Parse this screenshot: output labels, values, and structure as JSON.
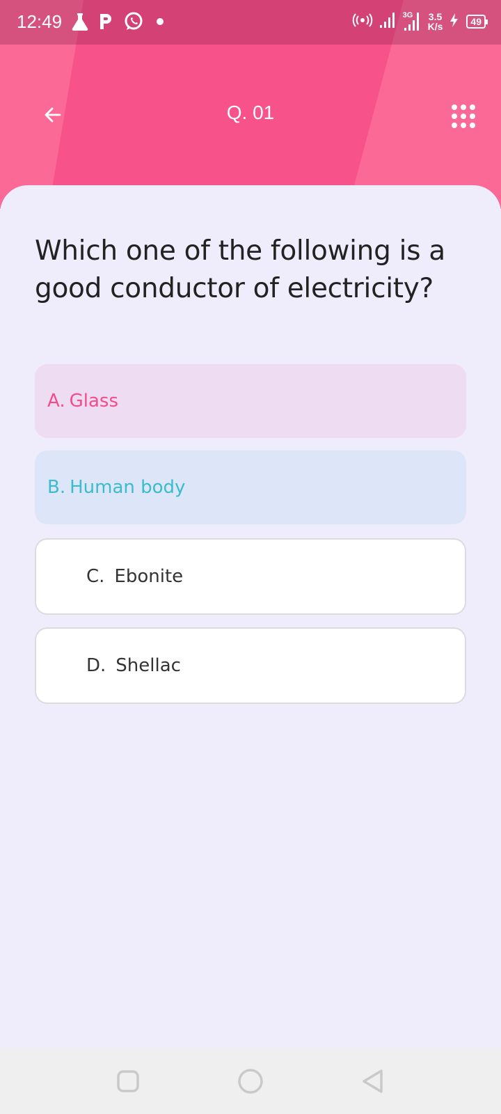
{
  "status_bar": {
    "time": "12:49",
    "network_speed_value": "3.5",
    "network_speed_unit": "K/s",
    "network_type": "3G",
    "battery_level": "49",
    "icons": [
      "flask-icon",
      "p-app-icon",
      "whatsapp-icon",
      "notification-dot-icon",
      "hotspot-icon",
      "signal-icon",
      "signal-3g-icon",
      "charging-icon",
      "battery-icon"
    ]
  },
  "toolbar": {
    "question_number": "Q. 01",
    "back_icon": "arrow-left-icon",
    "menu_icon": "grid-dots-icon"
  },
  "question": {
    "text": "Which one of the following is a good conductor of electricity?"
  },
  "options": [
    {
      "letter": "A.",
      "label": "Glass",
      "state": "wrong",
      "color": "#f54b8a"
    },
    {
      "letter": "B.",
      "label": "Human body",
      "state": "correct",
      "color": "#3bbccc"
    },
    {
      "letter": "C.",
      "label": "Ebonite",
      "state": "neutral"
    },
    {
      "letter": "D.",
      "label": "Shellac",
      "state": "neutral"
    }
  ],
  "nav_bar": {
    "icons": [
      "recents-square-icon",
      "home-circle-icon",
      "back-triangle-icon"
    ]
  },
  "colors": {
    "header": "#f8528a",
    "background": "#efecfc"
  }
}
